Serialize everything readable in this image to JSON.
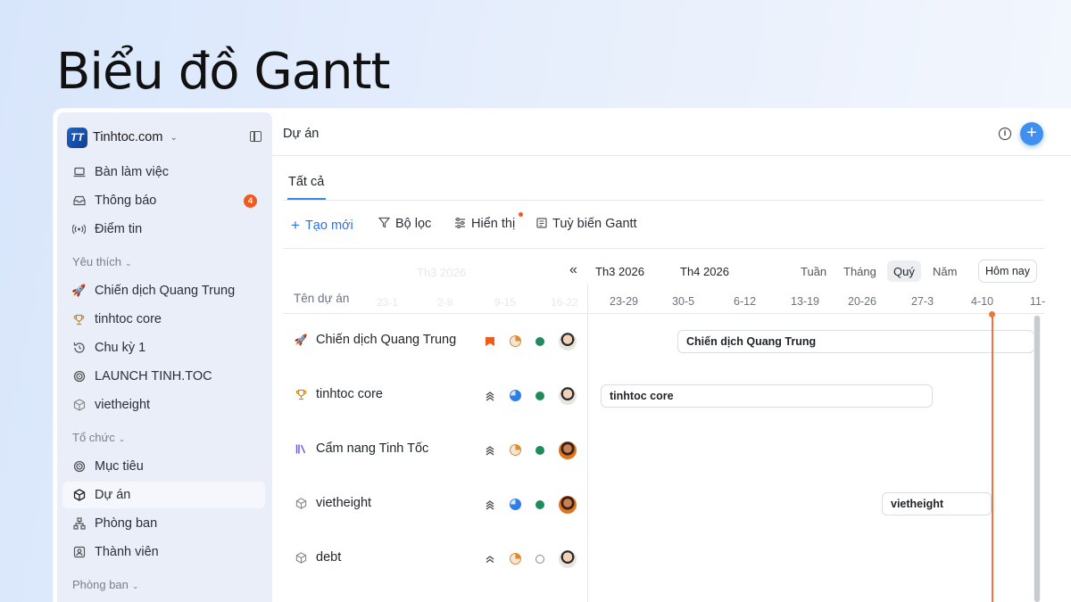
{
  "hero": {
    "title": "Biểu đồ Gantt"
  },
  "sidebar": {
    "workspace": "Tinhtoc.com",
    "items": [
      {
        "label": "Bàn làm việc",
        "icon": "laptop-icon"
      },
      {
        "label": "Thông báo",
        "icon": "inbox-icon",
        "badge": "4"
      },
      {
        "label": "Điểm tin",
        "icon": "broadcast-icon"
      }
    ],
    "favorites_label": "Yêu thích",
    "favorites": [
      {
        "label": "Chiến dịch Quang Trung",
        "icon": "rocket-icon"
      },
      {
        "label": "tinhtoc core",
        "icon": "trophy-icon"
      },
      {
        "label": "Chu kỳ 1",
        "icon": "cycle-icon"
      },
      {
        "label": "LAUNCH TINH.TOC",
        "icon": "target-icon"
      },
      {
        "label": "vietheight",
        "icon": "cube-icon"
      }
    ],
    "org_label": "Tổ chức",
    "org": [
      {
        "label": "Mục tiêu",
        "icon": "target-icon"
      },
      {
        "label": "Dự án",
        "icon": "cube-icon",
        "active": true
      },
      {
        "label": "Phòng ban",
        "icon": "org-chart-icon"
      },
      {
        "label": "Thành viên",
        "icon": "member-icon"
      }
    ],
    "dept_label": "Phòng ban"
  },
  "topbar": {
    "title": "Dự án"
  },
  "tabs": {
    "all": "Tất cả"
  },
  "toolbar": {
    "create": "Tạo mới",
    "filter": "Bộ lọc",
    "display": "Hiển thị",
    "customize": "Tuỳ biến Gantt"
  },
  "gantt": {
    "column_header": "Tên dự án",
    "months": [
      "Th3 2026",
      "Th4 2026"
    ],
    "ghost_month": "Th3 2026",
    "ghost_weeks": [
      "23-1",
      "2-8",
      "9-15",
      "16-22"
    ],
    "weeks": [
      "23-29",
      "30-5",
      "6-12",
      "13-19",
      "20-26",
      "27-3",
      "4-10",
      "11-"
    ],
    "zoom": [
      "Tuần",
      "Tháng",
      "Quý",
      "Năm"
    ],
    "zoom_active": "Quý",
    "today": "Hôm nay",
    "rows": [
      {
        "name": "Chiến dịch Quang Trung",
        "icon": "rocket-icon",
        "priority": "urgent",
        "progress": 0.25,
        "status": "on-track",
        "bar": "Chiến dịch Quang Trung"
      },
      {
        "name": "tinhtoc core",
        "icon": "trophy-icon",
        "priority": "high",
        "progress": 0.75,
        "status": "on-track",
        "bar": "tinhtoc core"
      },
      {
        "name": "Cẩm nang Tinh Tốc",
        "icon": "library-icon",
        "priority": "high",
        "progress": 0.25,
        "status": "on-track",
        "bar": ""
      },
      {
        "name": "vietheight",
        "icon": "cube-icon",
        "priority": "high",
        "progress": 0.75,
        "status": "on-track",
        "bar": "vietheight"
      },
      {
        "name": "debt",
        "icon": "cube-icon",
        "priority": "medium",
        "progress": 0.25,
        "status": "none",
        "bar": ""
      }
    ]
  },
  "colors": {
    "accent": "#3b82f6",
    "danger": "#f25a1d",
    "status_green": "#1f8a5b",
    "today_line": "#f0743a"
  }
}
